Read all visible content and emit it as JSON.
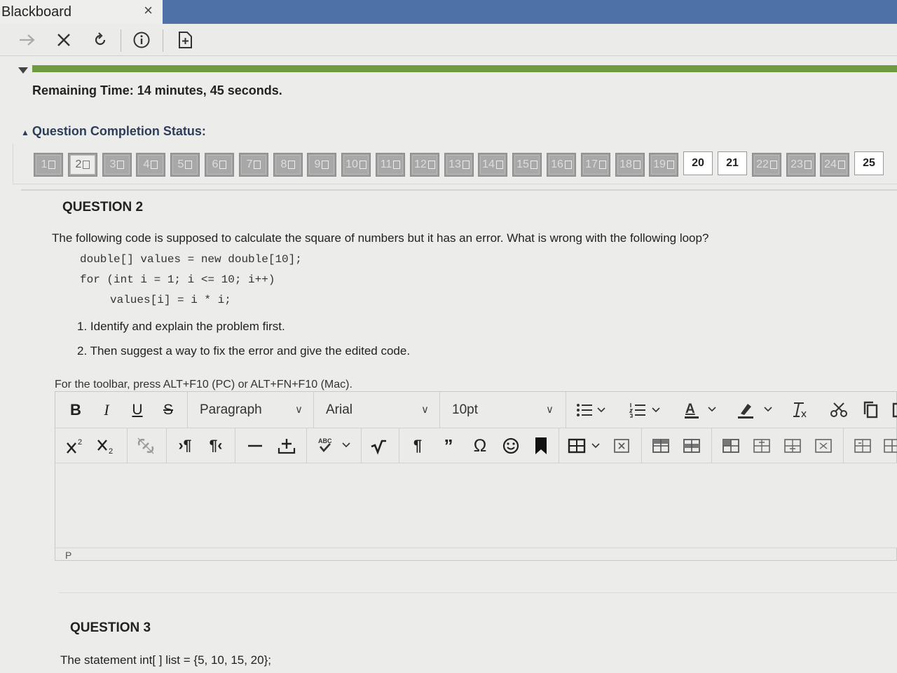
{
  "browser": {
    "tab_title": "Blackboard",
    "tab_close": "×",
    "toolbar_icons": [
      "forward-icon",
      "stop-icon",
      "reload-icon",
      "info-icon",
      "bookmark-add-icon"
    ]
  },
  "timer": {
    "progress_fraction": 1.0,
    "remaining_label": "Remaining Time:",
    "remaining_value": "14 minutes, 45 seconds."
  },
  "status": {
    "title": "Question Completion Status:",
    "questions": [
      {
        "label": "1",
        "state": "saved"
      },
      {
        "label": "2",
        "state": "current"
      },
      {
        "label": "3",
        "state": "saved"
      },
      {
        "label": "4",
        "state": "saved"
      },
      {
        "label": "5",
        "state": "saved"
      },
      {
        "label": "6",
        "state": "saved"
      },
      {
        "label": "7",
        "state": "saved"
      },
      {
        "label": "8",
        "state": "saved"
      },
      {
        "label": "9",
        "state": "saved"
      },
      {
        "label": "10",
        "state": "saved"
      },
      {
        "label": "11",
        "state": "saved"
      },
      {
        "label": "12",
        "state": "saved"
      },
      {
        "label": "13",
        "state": "saved"
      },
      {
        "label": "14",
        "state": "saved"
      },
      {
        "label": "15",
        "state": "saved"
      },
      {
        "label": "16",
        "state": "saved"
      },
      {
        "label": "17",
        "state": "saved"
      },
      {
        "label": "18",
        "state": "saved"
      },
      {
        "label": "19",
        "state": "saved"
      },
      {
        "label": "20",
        "state": "unanswered"
      },
      {
        "label": "21",
        "state": "unanswered"
      },
      {
        "label": "22",
        "state": "saved"
      },
      {
        "label": "23",
        "state": "saved"
      },
      {
        "label": "24",
        "state": "saved"
      },
      {
        "label": "25",
        "state": "unanswered"
      }
    ]
  },
  "question2": {
    "title": "QUESTION 2",
    "prompt": "The following code is supposed to calculate the square of numbers but it has an error.  What is wrong with the following loop?",
    "code": [
      "double[] values = new double[10];",
      "for (int i = 1; i <= 10; i++)",
      "values[i] = i * i;"
    ],
    "items": [
      "1. Identify and explain the problem first.",
      "2. Then suggest a way to fix the error and give the edited code."
    ]
  },
  "editor": {
    "hint": "For the toolbar, press ALT+F10 (PC) or ALT+FN+F10 (Mac).",
    "format_buttons": {
      "bold": "B",
      "italic": "I",
      "underline": "U",
      "strike": "S"
    },
    "paragraph_value": "Paragraph",
    "font_value": "Arial",
    "size_value": "10pt",
    "path": "P"
  },
  "question3": {
    "title": "QUESTION 3",
    "text": "The statement int[ ] list = {5, 10, 15, 20};"
  }
}
